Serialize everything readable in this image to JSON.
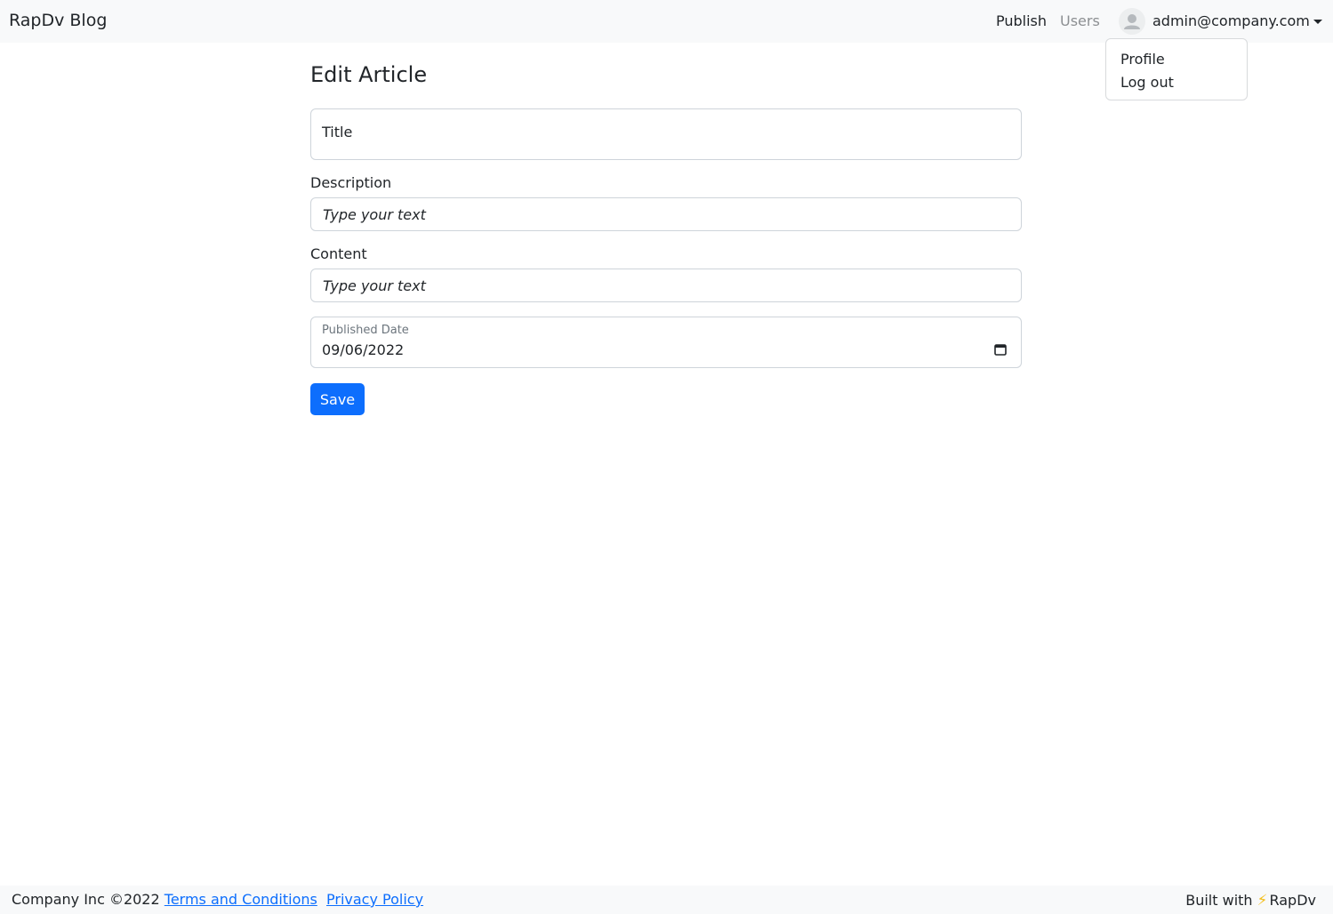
{
  "navbar": {
    "brand": "RapDv Blog",
    "links": [
      {
        "label": "Publish"
      },
      {
        "label": "Users"
      }
    ],
    "user_email": "admin@company.com"
  },
  "user_dropdown": {
    "items": [
      {
        "label": "Profile"
      },
      {
        "label": "Log out"
      }
    ]
  },
  "form": {
    "heading": "Edit Article",
    "title_label": "Title",
    "description_label": "Description",
    "description_placeholder": "Type your text",
    "content_label": "Content",
    "content_placeholder": "Type your text",
    "published_date_label": "Published Date",
    "published_date_value": "09/06/2022",
    "save_label": "Save"
  },
  "footer": {
    "copyright": "Company Inc ©2022",
    "terms_link": "Terms and Conditions",
    "privacy_link": "Privacy Policy",
    "built_with": "Built with",
    "built_with_brand": "RapDv",
    "bolt_glyph": "⚡"
  },
  "colors": {
    "primary": "#0d6efd",
    "navbar_bg": "#f8f9fa",
    "muted_link": "#8c8f92",
    "bolt": "#f4c022"
  }
}
